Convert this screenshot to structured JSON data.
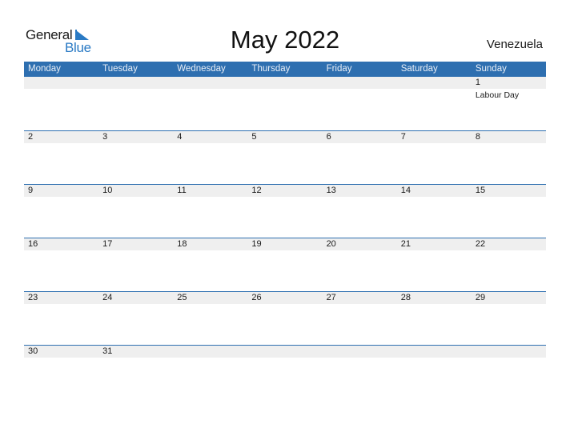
{
  "logo": {
    "line1": "General",
    "line2": "Blue"
  },
  "title": "May 2022",
  "country": "Venezuela",
  "colors": {
    "header": "#2e6fb0",
    "date_strip": "#efefef",
    "brand_blue": "#2a7ac4"
  },
  "weekdays": [
    "Monday",
    "Tuesday",
    "Wednesday",
    "Thursday",
    "Friday",
    "Saturday",
    "Sunday"
  ],
  "weeks": [
    [
      {
        "day": ""
      },
      {
        "day": ""
      },
      {
        "day": ""
      },
      {
        "day": ""
      },
      {
        "day": ""
      },
      {
        "day": ""
      },
      {
        "day": "1",
        "event": "Labour Day"
      }
    ],
    [
      {
        "day": "2"
      },
      {
        "day": "3"
      },
      {
        "day": "4"
      },
      {
        "day": "5"
      },
      {
        "day": "6"
      },
      {
        "day": "7"
      },
      {
        "day": "8"
      }
    ],
    [
      {
        "day": "9"
      },
      {
        "day": "10"
      },
      {
        "day": "11"
      },
      {
        "day": "12"
      },
      {
        "day": "13"
      },
      {
        "day": "14"
      },
      {
        "day": "15"
      }
    ],
    [
      {
        "day": "16"
      },
      {
        "day": "17"
      },
      {
        "day": "18"
      },
      {
        "day": "19"
      },
      {
        "day": "20"
      },
      {
        "day": "21"
      },
      {
        "day": "22"
      }
    ],
    [
      {
        "day": "23"
      },
      {
        "day": "24"
      },
      {
        "day": "25"
      },
      {
        "day": "26"
      },
      {
        "day": "27"
      },
      {
        "day": "28"
      },
      {
        "day": "29"
      }
    ],
    [
      {
        "day": "30"
      },
      {
        "day": "31"
      },
      {
        "day": ""
      },
      {
        "day": ""
      },
      {
        "day": ""
      },
      {
        "day": ""
      },
      {
        "day": ""
      }
    ]
  ]
}
